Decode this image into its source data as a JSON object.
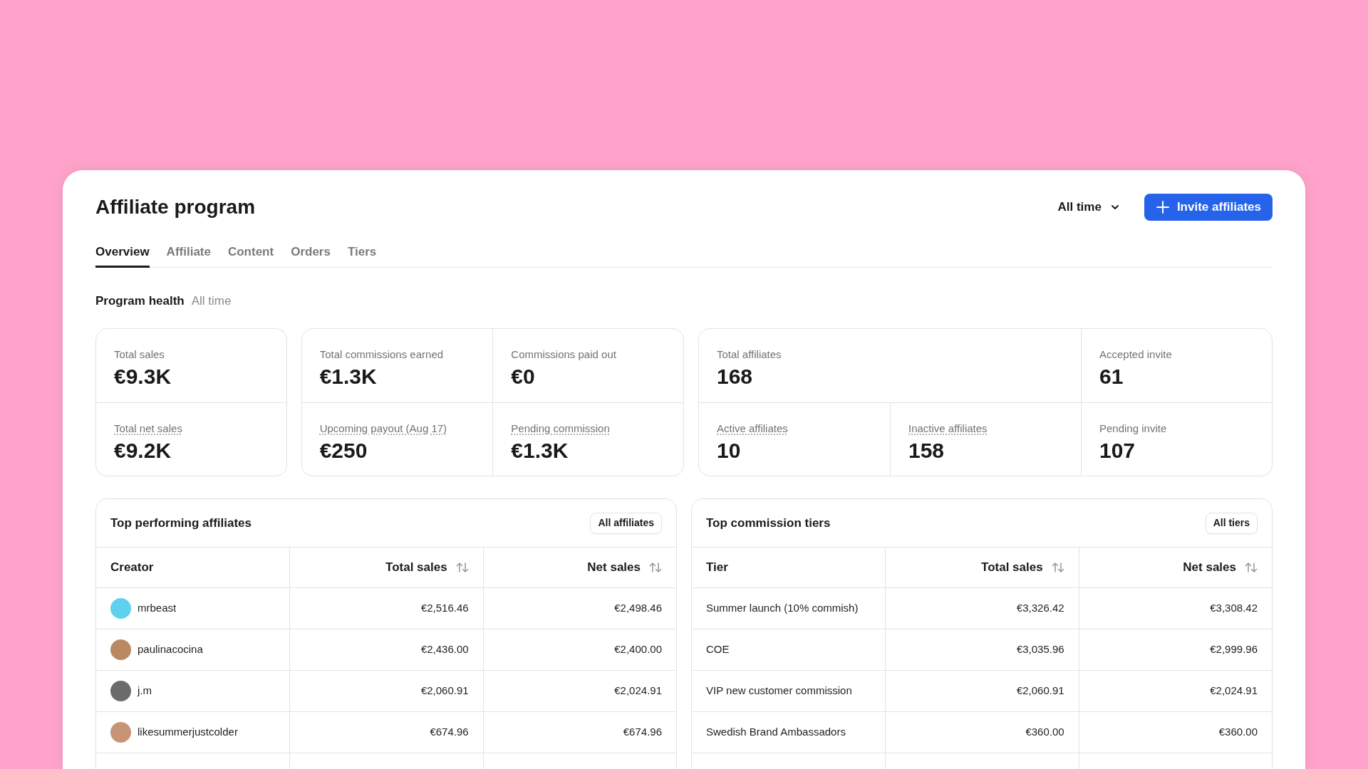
{
  "page": {
    "title": "Affiliate program",
    "period_dropdown": "All time",
    "invite_button": "Invite affiliates"
  },
  "tabs": [
    {
      "label": "Overview",
      "selected": true
    },
    {
      "label": "Affiliate",
      "selected": false
    },
    {
      "label": "Content",
      "selected": false
    },
    {
      "label": "Orders",
      "selected": false
    },
    {
      "label": "Tiers",
      "selected": false
    }
  ],
  "section": {
    "title": "Program health",
    "subtitle": "All time"
  },
  "stat_groups": [
    {
      "tiles": [
        {
          "label": "Total sales",
          "value": "€9.3K",
          "underlined": false,
          "wide": false
        },
        {
          "label": "Total net sales",
          "value": "€9.2K",
          "underlined": true,
          "wide": false
        }
      ]
    },
    {
      "tiles": [
        {
          "label": "Total commissions earned",
          "value": "€1.3K",
          "underlined": false,
          "wide": false
        },
        {
          "label": "Commissions paid out",
          "value": "€0",
          "underlined": false,
          "wide": false
        },
        {
          "label": "Upcoming payout (Aug 17)",
          "value": "€250",
          "underlined": true,
          "wide": false
        },
        {
          "label": "Pending commission",
          "value": "€1.3K",
          "underlined": true,
          "wide": false
        }
      ]
    },
    {
      "tiles": [
        {
          "label": "Total affiliates",
          "value": "168",
          "underlined": false,
          "wide": true
        },
        {
          "label": "Accepted invite",
          "value": "61",
          "underlined": false,
          "wide": false
        },
        {
          "label": "Active affiliates",
          "value": "10",
          "underlined": true,
          "wide": false
        },
        {
          "label": "Inactive affiliates",
          "value": "158",
          "underlined": true,
          "wide": false
        },
        {
          "label": "Pending invite",
          "value": "107",
          "underlined": false,
          "wide": false
        }
      ]
    }
  ],
  "tables": [
    {
      "title": "Top performing affiliates",
      "link_button": "All affiliates",
      "avatars": true,
      "columns": [
        {
          "label": "Creator",
          "sortable": false
        },
        {
          "label": "Total sales",
          "sortable": true
        },
        {
          "label": "Net sales",
          "sortable": true
        }
      ],
      "rows": [
        [
          "mrbeast",
          "€2,516.46",
          "€2,498.46"
        ],
        [
          "paulinacocina",
          "€2,436.00",
          "€2,400.00"
        ],
        [
          "j.m",
          "€2,060.91",
          "€2,024.91"
        ],
        [
          "likesummerjustcolder",
          "€674.96",
          "€674.96"
        ]
      ]
    },
    {
      "title": "Top commission tiers",
      "link_button": "All tiers",
      "avatars": false,
      "columns": [
        {
          "label": "Tier",
          "sortable": false
        },
        {
          "label": "Total sales",
          "sortable": true
        },
        {
          "label": "Net sales",
          "sortable": true
        }
      ],
      "rows": [
        [
          "Summer launch (10% commish)",
          "€3,326.42",
          "€3,308.42"
        ],
        [
          "COE",
          "€3,035.96",
          "€2,999.96"
        ],
        [
          "VIP new customer commission",
          "€2,060.91",
          "€2,024.91"
        ],
        [
          "Swedish Brand Ambassadors",
          "€360.00",
          "€360.00"
        ]
      ]
    }
  ]
}
